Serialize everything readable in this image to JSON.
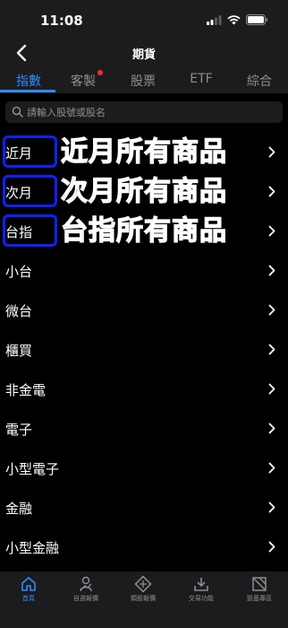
{
  "status": {
    "time": "11:08"
  },
  "nav": {
    "title": "期貨"
  },
  "tabs": [
    {
      "label": "指數",
      "active": true
    },
    {
      "label": "客製",
      "badge": true
    },
    {
      "label": "股票"
    },
    {
      "label": "ETF"
    },
    {
      "label": "綜合"
    }
  ],
  "search": {
    "placeholder": "請輸入股號或股名"
  },
  "rows": [
    {
      "label": "近月",
      "highlighted": true,
      "annotation": "近月所有商品"
    },
    {
      "label": "次月",
      "highlighted": true,
      "annotation": "次月所有商品"
    },
    {
      "label": "台指",
      "highlighted": true,
      "annotation": "台指所有商品"
    },
    {
      "label": "小台"
    },
    {
      "label": "微台"
    },
    {
      "label": "櫃買"
    },
    {
      "label": "非金電"
    },
    {
      "label": "電子"
    },
    {
      "label": "小型電子"
    },
    {
      "label": "金融"
    },
    {
      "label": "小型金融"
    }
  ],
  "bottom_nav": [
    {
      "label": "首頁",
      "icon": "home-icon",
      "active": true
    },
    {
      "label": "自選報價",
      "icon": "watchlist-icon"
    },
    {
      "label": "類股報價",
      "icon": "sector-icon"
    },
    {
      "label": "交易功能",
      "icon": "trade-icon"
    },
    {
      "label": "凱基專區",
      "icon": "kgi-icon"
    }
  ],
  "colors": {
    "accent": "#2f8cff",
    "annotation": "#1533ff",
    "badge": "#ff2d2d"
  }
}
